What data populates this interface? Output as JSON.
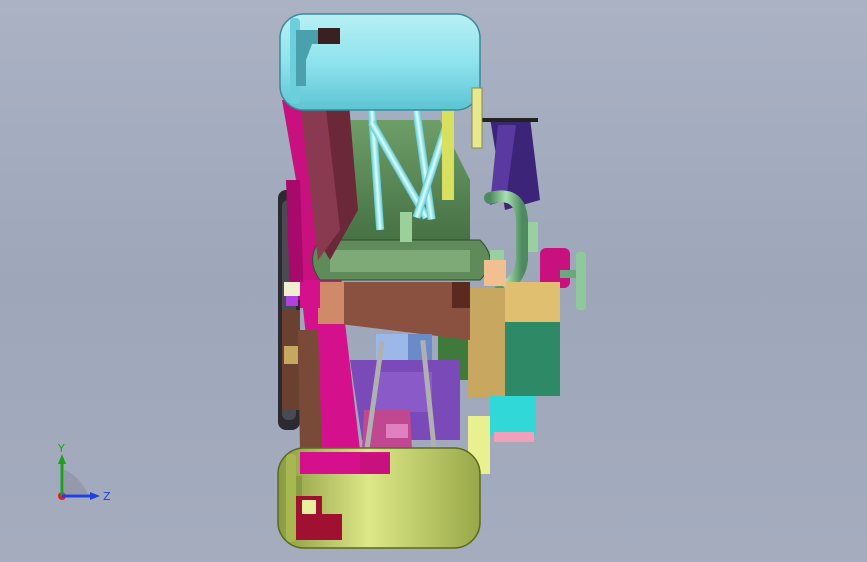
{
  "viewport": {
    "background_top": "#aab2c4",
    "background_bottom": "#a4acbe"
  },
  "model": {
    "description_icon": "cad-assembly-icon",
    "colors": {
      "top_tire": "#8fe3ee",
      "bottom_tire": "#b8c860",
      "chassis_green": "#5f8a5a",
      "magenta": "#d4108c",
      "purple": "#7a4ab8",
      "brown": "#8a5040",
      "tan": "#c8a860",
      "teal": "#2e8a66",
      "cyan": "#30d8d8",
      "dark_purple": "#4a2a88"
    }
  },
  "triad": {
    "y_label": "Y",
    "z_label": "Z",
    "y_color": "#20a020",
    "z_color": "#2040e0",
    "x_color": "#e02020"
  }
}
